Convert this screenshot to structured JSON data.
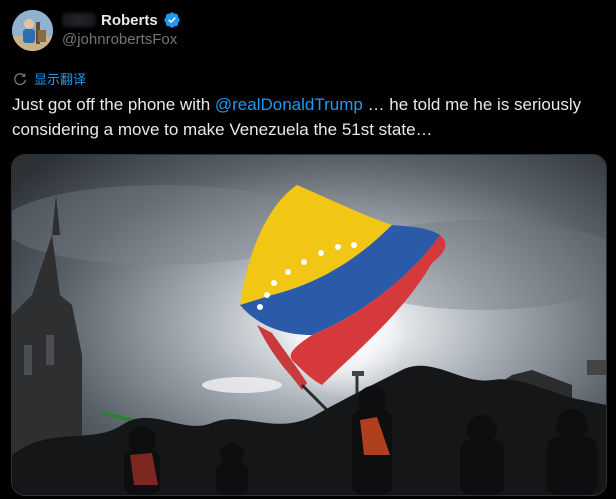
{
  "author": {
    "display_name": "Roberts",
    "handle": "@johnrobertsFox",
    "verified": true,
    "avatar_icon": "profile-avatar"
  },
  "translate": {
    "icon": "translate-icon",
    "label": "显示翻译"
  },
  "tweet": {
    "text_before": "Just got off the phone with ",
    "mention": "@realDonaldTrump",
    "text_after": " … he told me he is seriously considering a move to make Venezuela the 51st state…"
  },
  "media": {
    "image_subject": "venezuelan-flag-waving-photo"
  },
  "colors": {
    "background": "#000000",
    "text": "#e7e9ea",
    "muted": "#71767b",
    "accent": "#1d9bf0"
  }
}
